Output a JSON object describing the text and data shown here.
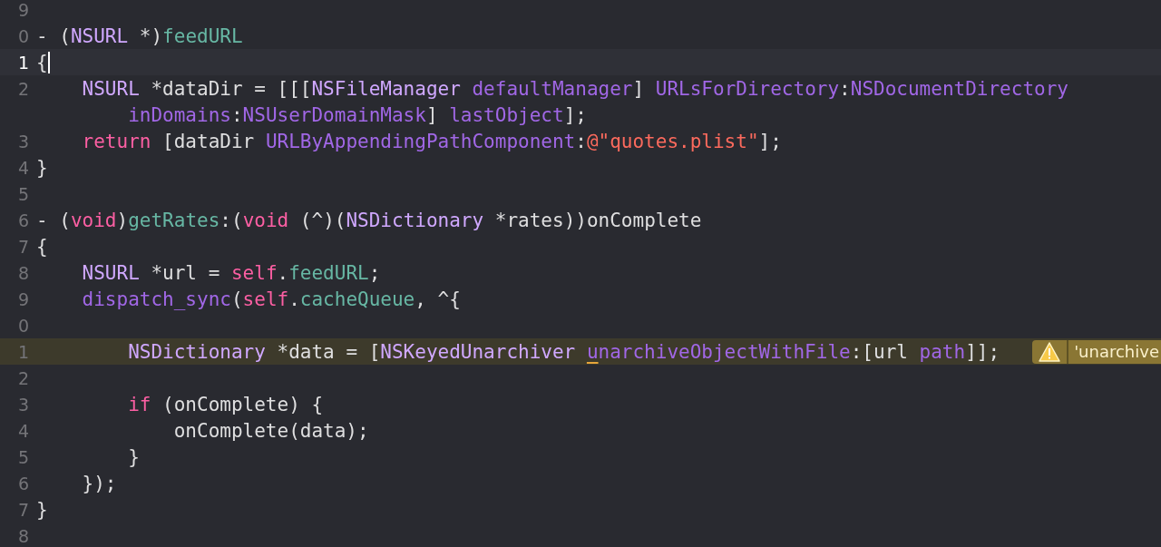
{
  "editor": {
    "lines": [
      {
        "number": "9",
        "current": false,
        "warning": false
      },
      {
        "number": "0",
        "current": false,
        "warning": false,
        "tokens": [
          {
            "text": "- (",
            "kind": "plain"
          },
          {
            "text": "NSURL",
            "kind": "type"
          },
          {
            "text": " *)",
            "kind": "plain"
          },
          {
            "text": "feedURL",
            "kind": "decl"
          }
        ]
      },
      {
        "number": "1",
        "current": true,
        "warning": false,
        "caret": true,
        "tokens": [
          {
            "text": "{",
            "kind": "plain"
          }
        ]
      },
      {
        "number": "2",
        "current": false,
        "warning": false,
        "tokens": [
          {
            "text": "    NSURL",
            "kind": "type"
          },
          {
            "text": " *dataDir = [[[",
            "kind": "plain"
          },
          {
            "text": "NSFileManager",
            "kind": "type"
          },
          {
            "text": " defaultManager",
            "kind": "method"
          },
          {
            "text": "] ",
            "kind": "plain"
          },
          {
            "text": "URLsForDirectory",
            "kind": "method"
          },
          {
            "text": ":",
            "kind": "plain"
          },
          {
            "text": "NSDocumentDirectory",
            "kind": "method"
          }
        ]
      },
      {
        "tokens": [
          {
            "text": "        inDomains",
            "kind": "method"
          },
          {
            "text": ":",
            "kind": "plain"
          },
          {
            "text": "NSUserDomainMask",
            "kind": "method"
          },
          {
            "text": "] ",
            "kind": "plain"
          },
          {
            "text": "lastObject",
            "kind": "method"
          },
          {
            "text": "];",
            "kind": "plain"
          }
        ]
      },
      {
        "number": "3",
        "current": false,
        "warning": false,
        "tokens": [
          {
            "text": "    return",
            "kind": "keyword"
          },
          {
            "text": " [dataDir ",
            "kind": "plain"
          },
          {
            "text": "URLByAppendingPathComponent",
            "kind": "method"
          },
          {
            "text": ":",
            "kind": "plain"
          },
          {
            "text": "@\"quotes.plist\"",
            "kind": "string"
          },
          {
            "text": "];",
            "kind": "plain"
          }
        ]
      },
      {
        "number": "4",
        "current": false,
        "warning": false,
        "tokens": [
          {
            "text": "}",
            "kind": "plain"
          }
        ]
      },
      {
        "number": "5",
        "current": false,
        "warning": false
      },
      {
        "number": "6",
        "current": false,
        "warning": false,
        "tokens": [
          {
            "text": "- (",
            "kind": "plain"
          },
          {
            "text": "void",
            "kind": "keyword"
          },
          {
            "text": ")",
            "kind": "plain"
          },
          {
            "text": "getRates",
            "kind": "decl"
          },
          {
            "text": ":(",
            "kind": "plain"
          },
          {
            "text": "void",
            "kind": "keyword"
          },
          {
            "text": " (^)(",
            "kind": "plain"
          },
          {
            "text": "NSDictionary",
            "kind": "type"
          },
          {
            "text": " *rates))onComplete",
            "kind": "plain"
          }
        ]
      },
      {
        "number": "7",
        "current": false,
        "warning": false,
        "tokens": [
          {
            "text": "{",
            "kind": "plain"
          }
        ]
      },
      {
        "number": "8",
        "current": false,
        "warning": false,
        "tokens": [
          {
            "text": "    NSURL",
            "kind": "type"
          },
          {
            "text": " *url = ",
            "kind": "plain"
          },
          {
            "text": "self",
            "kind": "keyword"
          },
          {
            "text": ".",
            "kind": "plain"
          },
          {
            "text": "feedURL",
            "kind": "decl"
          },
          {
            "text": ";",
            "kind": "plain"
          }
        ]
      },
      {
        "number": "9",
        "current": false,
        "warning": false,
        "tokens": [
          {
            "text": "    dispatch_sync",
            "kind": "method"
          },
          {
            "text": "(",
            "kind": "plain"
          },
          {
            "text": "self",
            "kind": "keyword"
          },
          {
            "text": ".",
            "kind": "plain"
          },
          {
            "text": "cacheQueue",
            "kind": "decl"
          },
          {
            "text": ", ^{",
            "kind": "plain"
          }
        ]
      },
      {
        "number": "0",
        "current": false,
        "warning": false
      },
      {
        "number": "1",
        "current": false,
        "warning": true,
        "tokens": [
          {
            "text": "        NSDictionary",
            "kind": "type"
          },
          {
            "text": " *data = [",
            "kind": "plain"
          },
          {
            "text": "NSKeyedUnarchiver ",
            "kind": "type"
          },
          {
            "text": "u",
            "kind": "method",
            "flagged": true
          },
          {
            "text": "narchiveObjectWithFile",
            "kind": "method"
          },
          {
            "text": ":[url ",
            "kind": "plain"
          },
          {
            "text": "path",
            "kind": "method"
          },
          {
            "text": "]];",
            "kind": "plain"
          }
        ],
        "annotation": {
          "message": "'unarchive"
        }
      },
      {
        "number": "2",
        "current": false,
        "warning": false
      },
      {
        "number": "3",
        "current": false,
        "warning": false,
        "tokens": [
          {
            "text": "        if",
            "kind": "keyword"
          },
          {
            "text": " (onComplete) {",
            "kind": "plain"
          }
        ]
      },
      {
        "number": "4",
        "current": false,
        "warning": false,
        "tokens": [
          {
            "text": "            onComplete(data);",
            "kind": "plain"
          }
        ]
      },
      {
        "number": "5",
        "current": false,
        "warning": false,
        "tokens": [
          {
            "text": "        }",
            "kind": "plain"
          }
        ]
      },
      {
        "number": "6",
        "current": false,
        "warning": false,
        "tokens": [
          {
            "text": "    });",
            "kind": "plain"
          }
        ]
      },
      {
        "number": "7",
        "current": false,
        "warning": false,
        "tokens": [
          {
            "text": "}",
            "kind": "plain"
          }
        ]
      },
      {
        "number": "8",
        "current": false,
        "warning": false
      }
    ]
  }
}
